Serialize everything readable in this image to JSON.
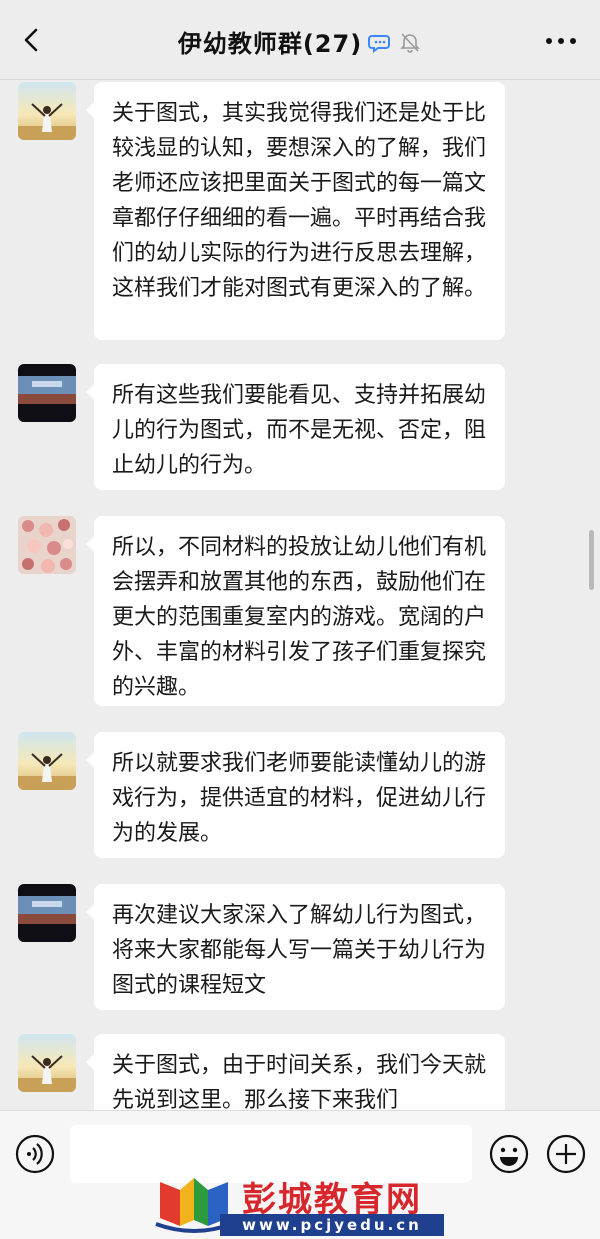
{
  "header": {
    "title": "伊幼教师群(27)",
    "back_icon": "chevron-left-icon",
    "more_icon": "more-dots-icon"
  },
  "messages": [
    {
      "avatar": "avatar-girl-sunset",
      "text": "关于图式，其实我觉得我们还是处于比较浅显的认知，要想深入的了解，我们老师还应该把里面关于图式的每一篇文章都仔仔细细的看一遍。平时再结合我们的幼儿实际的行为进行反思去理解，这样我们才能对图式有更深入的了解。"
    },
    {
      "avatar": "avatar-landscape-dark",
      "text": "所有这些我们要能看见、支持并拓展幼儿的行为图式，而不是无视、否定，阻止幼儿的行为。"
    },
    {
      "avatar": "avatar-flowers",
      "text": "所以，不同材料的投放让幼儿他们有机会摆弄和放置其他的东西，鼓励他们在更大的范围重复室内的游戏。宽阔的户外、丰富的材料引发了孩子们重复探究的兴趣。"
    },
    {
      "avatar": "avatar-girl-sunset",
      "text": "所以就要求我们老师要能读懂幼儿的游戏行为，提供适宜的材料，促进幼儿行为的发展。"
    },
    {
      "avatar": "avatar-landscape-dark",
      "text": "再次建议大家深入了解幼儿行为图式，将来大家都能每人写一篇关于幼儿行为图式的课程短文"
    },
    {
      "avatar": "avatar-girl-sunset",
      "text": "关于图式，由于时间关系，我们今天就先说到这里。那么接下来我们"
    }
  ],
  "input": {
    "value": ""
  },
  "watermark": {
    "text": "彭城教育网",
    "url": "www.pcjyedu.cn"
  },
  "colors": {
    "background": "#ededed",
    "bubble": "#ffffff",
    "watermark_red": "#d8272c",
    "watermark_blue": "#1f3f8f"
  }
}
